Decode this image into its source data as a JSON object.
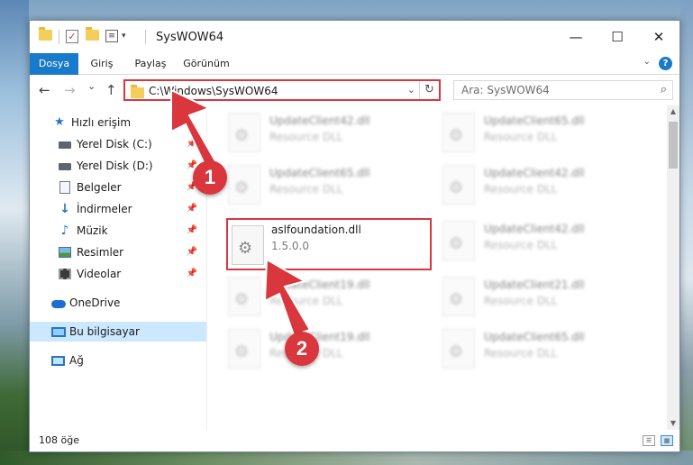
{
  "window": {
    "title": "SysWOW64",
    "minimize_glyph": "—",
    "maximize_glyph": "☐",
    "close_glyph": "✕"
  },
  "ribbon": {
    "tabs": [
      {
        "label": "Dosya"
      },
      {
        "label": "Giriş"
      },
      {
        "label": "Paylaş"
      },
      {
        "label": "Görünüm"
      }
    ],
    "help_glyph": "?"
  },
  "navigation": {
    "address": "C:\\Windows\\SysWOW64",
    "search_placeholder": "Ara: SysWOW64",
    "back_glyph": "←",
    "forward_glyph": "→",
    "recent_glyph": "⌄",
    "up_glyph": "↑"
  },
  "sidebar": {
    "items": [
      {
        "label": "Hızlı erişim",
        "icon": "star-icon"
      },
      {
        "label": "Yerel Disk (C:)",
        "icon": "drive-icon"
      },
      {
        "label": "Yerel Disk (D:)",
        "icon": "drive-icon"
      },
      {
        "label": "Belgeler",
        "icon": "documents-icon"
      },
      {
        "label": "İndirmeler",
        "icon": "download-icon"
      },
      {
        "label": "Müzik",
        "icon": "music-icon"
      },
      {
        "label": "Resimler",
        "icon": "pictures-icon"
      },
      {
        "label": "Videolar",
        "icon": "videos-icon"
      },
      {
        "label": "OneDrive",
        "icon": "cloud-icon"
      },
      {
        "label": "Bu bilgisayar",
        "icon": "computer-icon"
      },
      {
        "label": "Ağ",
        "icon": "network-icon"
      }
    ]
  },
  "files": [
    {
      "name": "UpdateClient42.dll",
      "desc": "Resource DLL"
    },
    {
      "name": "UpdateClient65.dll",
      "desc": "Resource DLL"
    },
    {
      "name": "UpdateClient65.dll",
      "desc": "Resource DLL"
    },
    {
      "name": "UpdateClient42.dll",
      "desc": "Resource DLL"
    },
    {
      "name": "aslfoundation.dll",
      "desc": "1.5.0.0"
    },
    {
      "name": "UpdateClient42.dll",
      "desc": "Resource DLL"
    },
    {
      "name": "UpdateClient19.dll",
      "desc": "Resource DLL"
    },
    {
      "name": "UpdateClient21.dll",
      "desc": "Resource DLL"
    },
    {
      "name": "UpdateClient19.dll",
      "desc": "Resource DLL"
    },
    {
      "name": "UpdateClient65.dll",
      "desc": "Resource DLL"
    }
  ],
  "status": {
    "item_count": "108 öğe"
  },
  "annotations": {
    "step1": "1",
    "step2": "2",
    "color": "#d9363e"
  },
  "colors": {
    "accent": "#1979ca",
    "highlight": "#d9363e",
    "selection": "#cce8ff"
  }
}
